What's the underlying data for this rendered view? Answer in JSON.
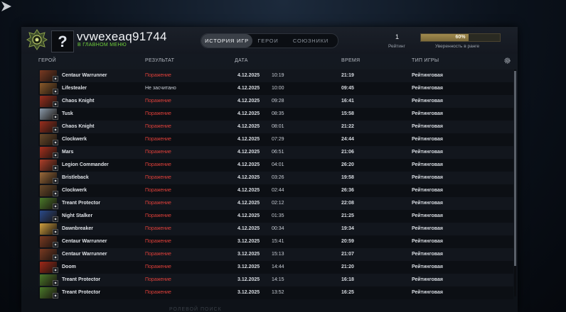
{
  "header": {
    "username": "vvwexeaq91744",
    "status": "В ГЛАВНОМ МЕНЮ",
    "avatar_glyph": "?",
    "rank_emblem_icon": "rank-emblem-icon"
  },
  "tabs": [
    {
      "label": "ИСТОРИЯ ИГР",
      "active": true
    },
    {
      "label": "ГЕРОИ",
      "active": false
    },
    {
      "label": "СОЮЗНИКИ",
      "active": false
    }
  ],
  "rank": {
    "value": "1",
    "label": "Рейтинг"
  },
  "confidence": {
    "percent": 60,
    "text": "60%",
    "label": "Уверенность в ранге"
  },
  "columns": {
    "hero": "ГЕРОЙ",
    "result": "РЕЗУЛЬТАТ",
    "date": "ДАТА",
    "duration": "ВРЕМЯ",
    "game_type": "ТИП ИГРЫ"
  },
  "matches": [
    {
      "hero": "Centaur Warrunner",
      "result": "Поражение",
      "loss": true,
      "date": "4.12.2025",
      "time": "10:19",
      "duration": "21:19",
      "type": "Рейтинговая",
      "color": "#7a3a22"
    },
    {
      "hero": "Lifestealer",
      "result": "Не засчитано",
      "loss": false,
      "date": "4.12.2025",
      "time": "10:00",
      "duration": "09:45",
      "type": "Рейтинговая",
      "color": "#8a5a2a"
    },
    {
      "hero": "Chaos Knight",
      "result": "Поражение",
      "loss": true,
      "date": "4.12.2025",
      "time": "09:28",
      "duration": "16:41",
      "type": "Рейтинговая",
      "color": "#9a2e1e"
    },
    {
      "hero": "Tusk",
      "result": "Поражение",
      "loss": true,
      "date": "4.12.2025",
      "time": "08:35",
      "duration": "15:58",
      "type": "Рейтинговая",
      "color": "#8a9aaa"
    },
    {
      "hero": "Chaos Knight",
      "result": "Поражение",
      "loss": true,
      "date": "4.12.2025",
      "time": "08:01",
      "duration": "21:22",
      "type": "Рейтинговая",
      "color": "#9a2e1e"
    },
    {
      "hero": "Clockwerk",
      "result": "Поражение",
      "loss": true,
      "date": "4.12.2025",
      "time": "07:29",
      "duration": "24:44",
      "type": "Рейтинговая",
      "color": "#6a4a2a"
    },
    {
      "hero": "Mars",
      "result": "Поражение",
      "loss": true,
      "date": "4.12.2025",
      "time": "06:51",
      "duration": "21:06",
      "type": "Рейтинговая",
      "color": "#a8301e"
    },
    {
      "hero": "Legion Commander",
      "result": "Поражение",
      "loss": true,
      "date": "4.12.2025",
      "time": "04:01",
      "duration": "26:20",
      "type": "Рейтинговая",
      "color": "#b0402a"
    },
    {
      "hero": "Bristleback",
      "result": "Поражение",
      "loss": true,
      "date": "4.12.2025",
      "time": "03:26",
      "duration": "19:58",
      "type": "Рейтинговая",
      "color": "#9a6a3a"
    },
    {
      "hero": "Clockwerk",
      "result": "Поражение",
      "loss": true,
      "date": "4.12.2025",
      "time": "02:44",
      "duration": "26:36",
      "type": "Рейтинговая",
      "color": "#6a4a2a"
    },
    {
      "hero": "Treant Protector",
      "result": "Поражение",
      "loss": true,
      "date": "4.12.2025",
      "time": "02:12",
      "duration": "22:08",
      "type": "Рейтинговая",
      "color": "#4a7a2a"
    },
    {
      "hero": "Night Stalker",
      "result": "Поражение",
      "loss": true,
      "date": "4.12.2025",
      "time": "01:35",
      "duration": "21:25",
      "type": "Рейтинговая",
      "color": "#2a4a8a"
    },
    {
      "hero": "Dawnbreaker",
      "result": "Поражение",
      "loss": true,
      "date": "4.12.2025",
      "time": "00:34",
      "duration": "19:34",
      "type": "Рейтинговая",
      "color": "#d0a040"
    },
    {
      "hero": "Centaur Warrunner",
      "result": "Поражение",
      "loss": true,
      "date": "3.12.2025",
      "time": "15:41",
      "duration": "20:59",
      "type": "Рейтинговая",
      "color": "#7a3a22"
    },
    {
      "hero": "Centaur Warrunner",
      "result": "Поражение",
      "loss": true,
      "date": "3.12.2025",
      "time": "15:13",
      "duration": "21:07",
      "type": "Рейтинговая",
      "color": "#7a3a22"
    },
    {
      "hero": "Doom",
      "result": "Поражение",
      "loss": true,
      "date": "3.12.2025",
      "time": "14:44",
      "duration": "21:20",
      "type": "Рейтинговая",
      "color": "#a02818"
    },
    {
      "hero": "Treant Protector",
      "result": "Поражение",
      "loss": true,
      "date": "3.12.2025",
      "time": "14:15",
      "duration": "16:18",
      "type": "Рейтинговая",
      "color": "#4a7a2a"
    },
    {
      "hero": "Treant Protector",
      "result": "Поражение",
      "loss": true,
      "date": "3.12.2025",
      "time": "13:52",
      "duration": "16:25",
      "type": "Рейтинговая",
      "color": "#4a7a2a"
    }
  ],
  "footer": {
    "faded_label": "РОЛЕВОЙ ПОИСК"
  },
  "icons": {
    "gear": "gear-icon",
    "back": "back-arrow-icon"
  }
}
